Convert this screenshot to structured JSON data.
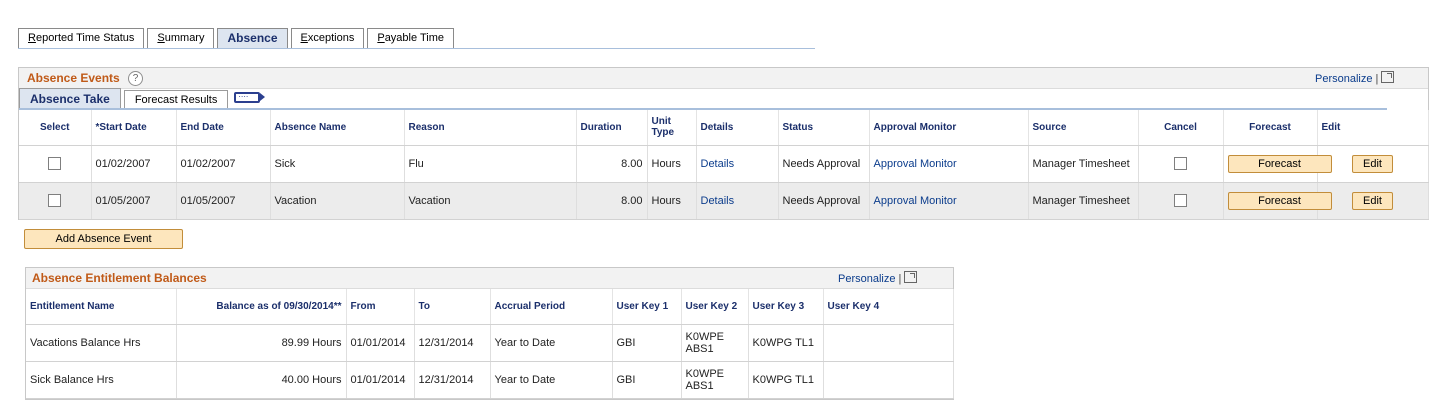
{
  "top_tabs": [
    {
      "label": "Reported Time Status",
      "key_letter": "R",
      "rest": "eported Time Status",
      "active": false
    },
    {
      "label": "Summary",
      "key_letter": "S",
      "rest": "ummary",
      "active": false
    },
    {
      "label": "Absence",
      "active": true
    },
    {
      "label": "Exceptions",
      "key_letter": "E",
      "rest": "xceptions",
      "active": false
    },
    {
      "label": "Payable Time",
      "key_letter": "P",
      "rest": "ayable Time",
      "active": false
    }
  ],
  "absence_events": {
    "title": "Absence Events",
    "help_icon": "?",
    "personalize": "Personalize",
    "separator": "|",
    "tabs": [
      {
        "label": "Absence Take",
        "active": true
      },
      {
        "label": "Forecast Results",
        "active": false
      }
    ],
    "columns": {
      "select": "Select",
      "start_date": "*Start Date",
      "end_date": "End Date",
      "absence_name": "Absence Name",
      "reason": "Reason",
      "duration": "Duration",
      "unit_type": "Unit Type",
      "details": "Details",
      "status": "Status",
      "approval_monitor": "Approval Monitor",
      "source": "Source",
      "cancel": "Cancel",
      "forecast": "Forecast",
      "edit": "Edit"
    },
    "rows": [
      {
        "start_date": "01/02/2007",
        "end_date": "01/02/2007",
        "absence_name": "Sick",
        "reason": "Flu",
        "duration": "8.00",
        "unit_type": "Hours",
        "details": "Details",
        "status": "Needs Approval",
        "approval_monitor": "Approval Monitor",
        "source": "Manager Timesheet",
        "forecast_btn": "Forecast",
        "edit_btn": "Edit"
      },
      {
        "start_date": "01/05/2007",
        "end_date": "01/05/2007",
        "absence_name": "Vacation",
        "reason": "Vacation",
        "duration": "8.00",
        "unit_type": "Hours",
        "details": "Details",
        "status": "Needs Approval",
        "approval_monitor": "Approval Monitor",
        "source": "Manager Timesheet",
        "forecast_btn": "Forecast",
        "edit_btn": "Edit"
      }
    ],
    "add_button": "Add Absence Event"
  },
  "entitlements": {
    "title": "Absence Entitlement Balances",
    "personalize": "Personalize",
    "separator": "|",
    "columns": {
      "name": "Entitlement Name",
      "balance": "Balance as of 09/30/2014**",
      "from": "From",
      "to": "To",
      "accrual": "Accrual Period",
      "uk1": "User Key 1",
      "uk2": "User Key 2",
      "uk3": "User Key 3",
      "uk4": "User Key 4"
    },
    "rows": [
      {
        "name": "Vacations Balance Hrs",
        "balance": "89.99 Hours",
        "from": "01/01/2014",
        "to": "12/31/2014",
        "accrual": "Year to Date",
        "uk1": "GBI",
        "uk2": "K0WPE ABS1",
        "uk3": "K0WPG TL1",
        "uk4": ""
      },
      {
        "name": "Sick Balance Hrs",
        "balance": "40.00 Hours",
        "from": "01/01/2014",
        "to": "12/31/2014",
        "accrual": "Year to Date",
        "uk1": "GBI",
        "uk2": "K0WPE ABS1",
        "uk3": "K0WPG TL1",
        "uk4": ""
      }
    ]
  },
  "colors": {
    "section_title": "#c05a18",
    "link": "#0b3c8c",
    "button_fill": "#fde6bd",
    "active_tab": "#dde5f0"
  }
}
